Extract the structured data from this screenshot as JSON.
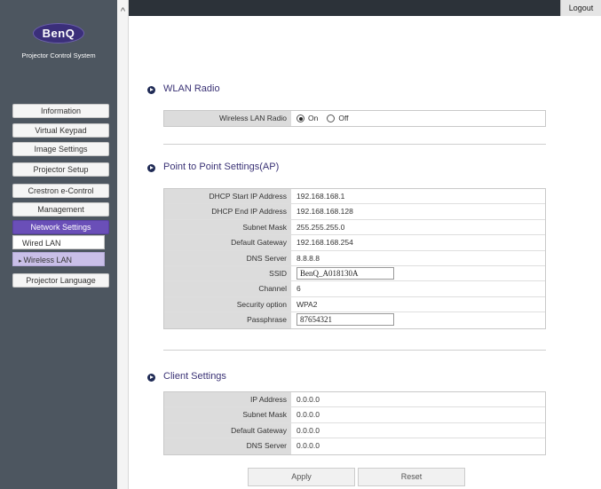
{
  "sidebar": {
    "logo_text": "BenQ",
    "system_title": "Projector Control System",
    "scroll_up_glyph": "^",
    "items": [
      {
        "label": "Information"
      },
      {
        "label": "Virtual Keypad"
      },
      {
        "label": "Image Settings"
      },
      {
        "label": "Projector Setup"
      },
      {
        "label": "Crestron e-Control"
      },
      {
        "label": "Management"
      },
      {
        "label": "Network Settings"
      },
      {
        "label": "Projector Language"
      }
    ],
    "subitems": [
      {
        "label": "Wired LAN"
      },
      {
        "label": "Wireless LAN",
        "marker": "▸"
      }
    ]
  },
  "topbar": {
    "logout_label": "Logout"
  },
  "wlan_radio": {
    "title": "WLAN Radio",
    "label": "Wireless LAN Radio",
    "option_on": "On",
    "option_off": "Off",
    "selected": "On"
  },
  "p2p": {
    "title": "Point to Point Settings(AP)",
    "rows": [
      {
        "label": "DHCP Start IP Address",
        "value": "192.168.168.1"
      },
      {
        "label": "DHCP End IP Address",
        "value": "192.168.168.128"
      },
      {
        "label": "Subnet Mask",
        "value": "255.255.255.0"
      },
      {
        "label": "Default Gateway",
        "value": "192.168.168.254"
      },
      {
        "label": "DNS Server",
        "value": "8.8.8.8"
      },
      {
        "label": "SSID",
        "value": "BenQ_A018130A"
      },
      {
        "label": "Channel",
        "value": "6"
      },
      {
        "label": "Security option",
        "value": "WPA2"
      },
      {
        "label": "Passphrase",
        "value": "87654321"
      }
    ]
  },
  "client": {
    "title": "Client Settings",
    "rows": [
      {
        "label": "IP Address",
        "value": "0.0.0.0"
      },
      {
        "label": "Subnet Mask",
        "value": "0.0.0.0"
      },
      {
        "label": "Default Gateway",
        "value": "0.0.0.0"
      },
      {
        "label": "DNS Server",
        "value": "0.0.0.0"
      }
    ]
  },
  "actions": {
    "apply_label": "Apply",
    "reset_label": "Reset"
  },
  "colors": {
    "sidebar_bg": "#4d5660",
    "active_nav": "#6a4fb8",
    "selected_sub": "#c9bfe8",
    "heading": "#3b3376",
    "topbar": "#2c3239"
  }
}
